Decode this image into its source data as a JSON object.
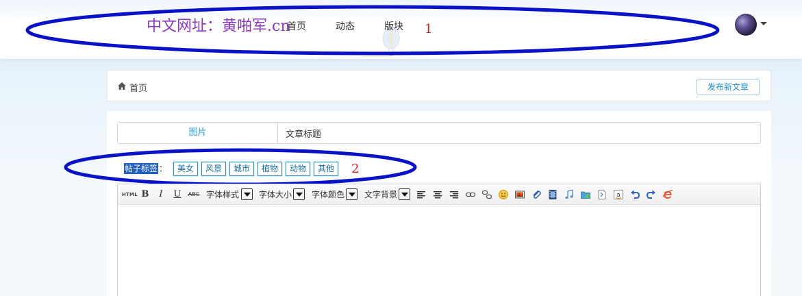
{
  "header": {
    "site_url": "http://www.mabsky.com",
    "site_name": "中文网址：黄啪军.cn",
    "nav": [
      {
        "label": "首页"
      },
      {
        "label": "动态"
      },
      {
        "label": "版块"
      }
    ],
    "annotation_1": "1"
  },
  "breadcrumb": {
    "home_label": "首页",
    "publish_label": "发布新文章"
  },
  "form": {
    "title_addon": "图片",
    "title_value": "文章标题",
    "tags_label": "帖子标签",
    "tags_colon": "：",
    "tags": [
      "美女",
      "风景",
      "城市",
      "植物",
      "动物",
      "其他"
    ],
    "annotation_2": "2"
  },
  "toolbar": {
    "html_label": "HTML",
    "bold_label": "B",
    "italic_label": "I",
    "underline_label": "U",
    "strike_label": "ABC",
    "font_style_label": "字体样式",
    "font_size_label": "字体大小",
    "font_color_label": "字体颜色",
    "text_bg_label": "文字背景"
  },
  "colors": {
    "annotation_ellipse": "#0a12c8",
    "annotation_number": "#d21e1e",
    "accent": "#2d9ad8",
    "site_name": "#8b35c4"
  }
}
